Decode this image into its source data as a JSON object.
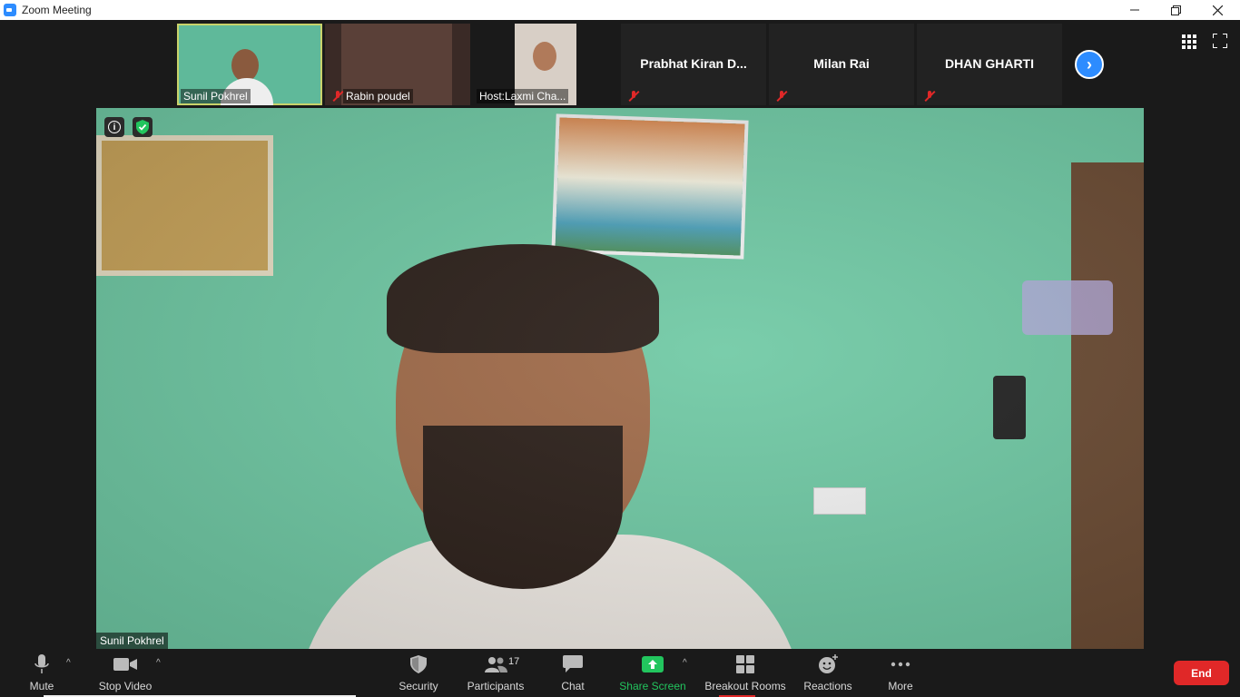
{
  "window": {
    "title": "Zoom Meeting",
    "controls": [
      "minimize-icon",
      "restore-icon",
      "close-icon"
    ]
  },
  "strip": {
    "participants": [
      {
        "name": "Sunil Pokhrel",
        "video": true,
        "muted": false,
        "active": true
      },
      {
        "name": "Rabin poudel",
        "video": true,
        "muted": true
      },
      {
        "name": "Host:Laxmi Cha...",
        "video": true,
        "muted": false
      },
      {
        "name": "Prabhat  Kiran  D...",
        "video": false,
        "muted": true
      },
      {
        "name": "Milan Rai",
        "video": false,
        "muted": true
      },
      {
        "name": "DHAN GHARTI",
        "video": false,
        "muted": true
      }
    ],
    "next_icon": "chevron-right-icon",
    "view_icons": [
      "gallery-view-icon",
      "fullscreen-icon"
    ]
  },
  "main_video": {
    "speaker_name": "Sunil Pokhrel",
    "overlay_icons": [
      "info-icon",
      "shield-check-icon"
    ]
  },
  "toolbar": {
    "mute_label": "Mute",
    "stop_video_label": "Stop Video",
    "security_label": "Security",
    "participants_label": "Participants",
    "participants_count": "17",
    "chat_label": "Chat",
    "share_screen_label": "Share Screen",
    "breakout_label": "Breakout Rooms",
    "reactions_label": "Reactions",
    "more_label": "More",
    "end_label": "End"
  },
  "colors": {
    "accent_blue": "#2d8cff",
    "share_green": "#22c55e",
    "end_red": "#e02828",
    "active_speaker_border": "#c8d26a",
    "toolbar_bg": "#1a1a1a"
  }
}
